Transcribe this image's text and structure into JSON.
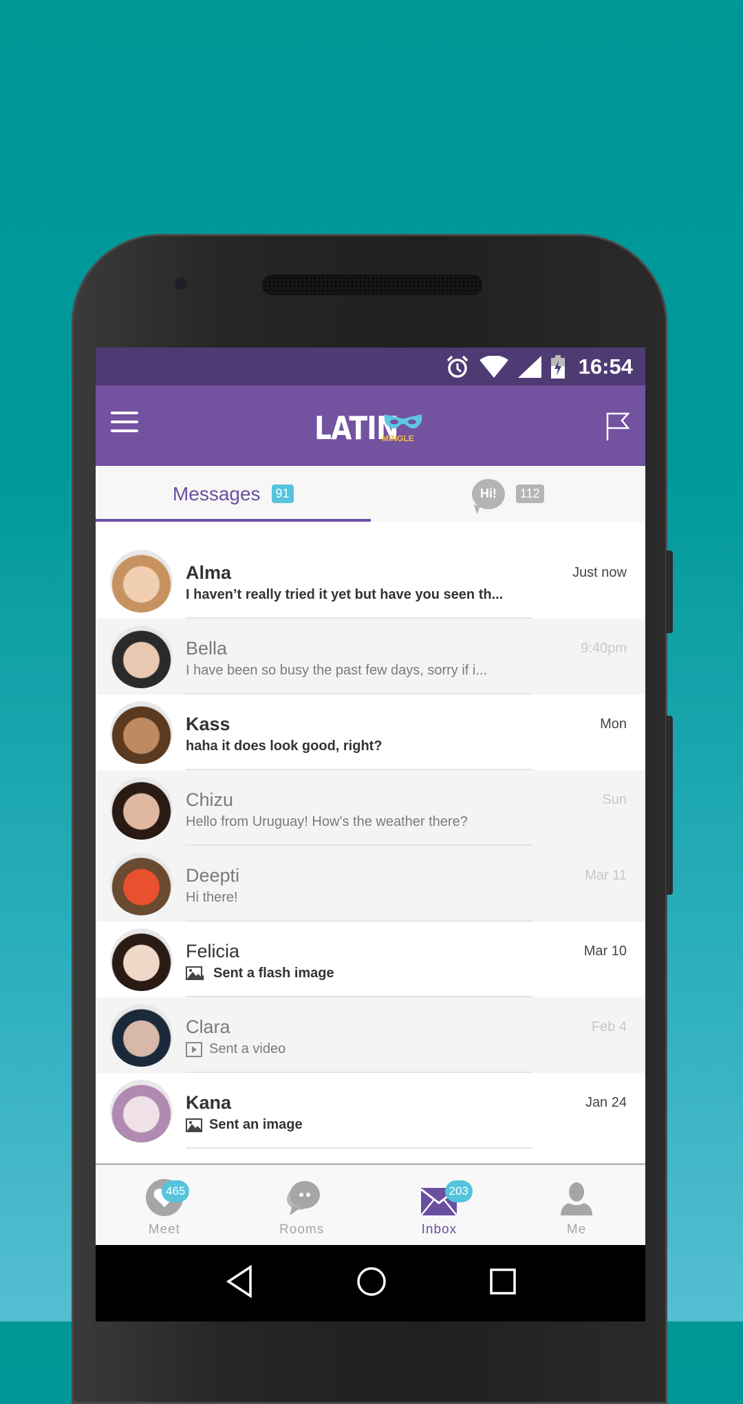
{
  "status_bar": {
    "time": "16:54",
    "icons": [
      "alarm-icon",
      "wifi-icon",
      "signal-icon",
      "battery-charging-icon"
    ]
  },
  "app_bar": {
    "logo_main": "LATIN",
    "logo_sub": "MINGLE",
    "menu_icon": "hamburger-menu-icon",
    "flag_icon": "flag-icon"
  },
  "tabs": {
    "messages_label": "Messages",
    "messages_count": "91",
    "hi_label": "Hi!",
    "hi_count": "112"
  },
  "colors": {
    "brand_purple": "#7352a0",
    "status_purple": "#4f3b74",
    "badge_blue": "#55c3dc"
  },
  "conversations": [
    {
      "name": "Alma",
      "preview": "I haven’t really tried it yet but have you seen th...",
      "time": "Just now",
      "unread": true
    },
    {
      "name": "Bella",
      "preview": "I have been so busy the past few days, sorry if i...",
      "time": "9:40pm",
      "unread": false
    },
    {
      "name": "Kass",
      "preview": "haha it does look good, right?",
      "time": "Mon",
      "unread": true
    },
    {
      "name": "Chizu",
      "preview": "Hello from Uruguay! How’s the weather there?",
      "time": "Sun",
      "unread": false
    },
    {
      "name": "Deepti",
      "preview": "Hi there!",
      "time": "Mar 11",
      "unread": false
    },
    {
      "name": "Felicia",
      "preview": "Sent a flash image",
      "preview_icon": "flash-image-icon",
      "time": "Mar 10",
      "unread": true
    },
    {
      "name": "Clara",
      "preview": "Sent a video",
      "preview_icon": "video-icon",
      "time": "Feb 4",
      "unread": false
    },
    {
      "name": "Kana",
      "preview": "Sent an image",
      "preview_icon": "image-icon",
      "time": "Jan 24",
      "unread": true
    }
  ],
  "bottom_nav": [
    {
      "label": "Meet",
      "icon": "heart-icon",
      "badge": "465",
      "active": false
    },
    {
      "label": "Rooms",
      "icon": "chat-bubbles-icon",
      "badge": null,
      "active": false
    },
    {
      "label": "Inbox",
      "icon": "envelope-icon",
      "badge": "203",
      "active": true
    },
    {
      "label": "Me",
      "icon": "person-icon",
      "badge": null,
      "active": false
    }
  ],
  "system_nav": [
    "back-icon",
    "home-icon",
    "recents-icon"
  ]
}
